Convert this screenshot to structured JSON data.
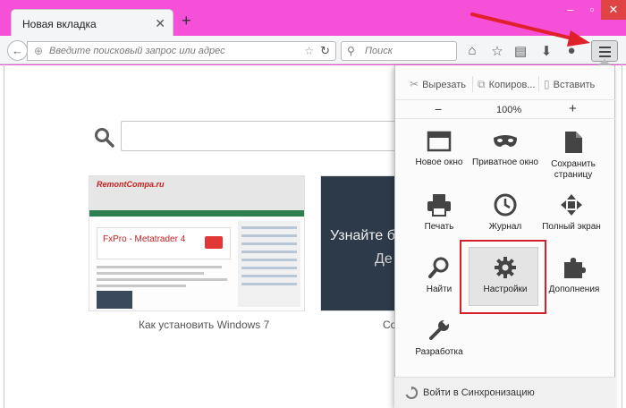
{
  "tab": {
    "title": "Новая вкладка"
  },
  "navbar": {
    "url_placeholder": "Введите поисковый запрос или адрес",
    "search_placeholder": "Поиск"
  },
  "content": {
    "tiles": [
      {
        "caption": "Как установить Windows 7",
        "thumb_logo": "RemontCompa.ru",
        "thumb_ad": "FxPro - Metatrader 4"
      },
      {
        "caption": "Со",
        "thumb_text": "Узнайте бол",
        "thumb_text2": "Де"
      }
    ]
  },
  "menu": {
    "edit": {
      "cut": "Вырезать",
      "copy": "Копиров...",
      "paste": "Вставить"
    },
    "zoom": {
      "out": "−",
      "value": "100%",
      "in": "+"
    },
    "items": [
      {
        "label": "Новое окно",
        "icon": "new-window-icon"
      },
      {
        "label": "Приватное окно",
        "icon": "private-mask-icon"
      },
      {
        "label": "Сохранить страницу",
        "icon": "save-page-icon"
      },
      {
        "label": "Печать",
        "icon": "printer-icon"
      },
      {
        "label": "Журнал",
        "icon": "history-clock-icon"
      },
      {
        "label": "Полный экран",
        "icon": "fullscreen-icon"
      },
      {
        "label": "Найти",
        "icon": "search-icon"
      },
      {
        "label": "Настройки",
        "icon": "gear-icon"
      },
      {
        "label": "Дополнения",
        "icon": "puzzle-icon"
      },
      {
        "label": "Разработка",
        "icon": "wrench-icon"
      }
    ],
    "sync_label": "Войти в Синхронизацию"
  },
  "colors": {
    "background": "#f64fd8",
    "annotation_red": "#d3202a"
  }
}
